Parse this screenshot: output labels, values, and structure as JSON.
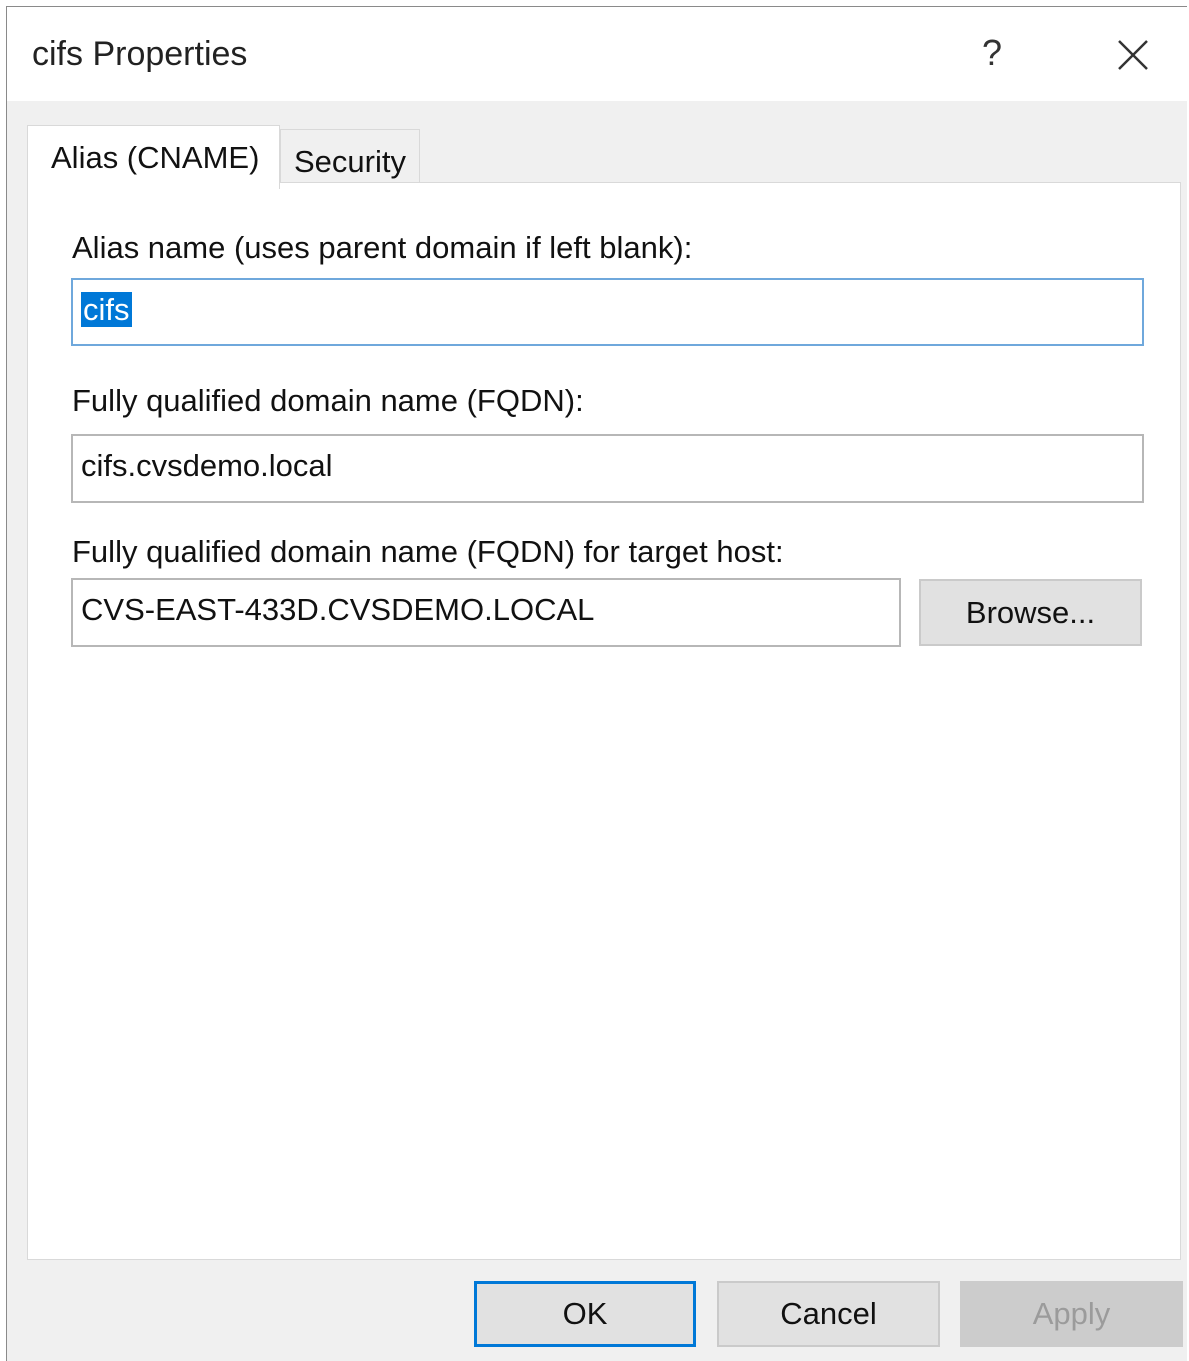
{
  "window": {
    "title": "cifs Properties",
    "help_glyph": "?",
    "close_icon": "close-icon"
  },
  "tabs": [
    {
      "label": "Alias (CNAME)",
      "active": true
    },
    {
      "label": "Security",
      "active": false
    }
  ],
  "form": {
    "alias_label": "Alias name (uses parent domain if left blank):",
    "alias_value": "cifs",
    "fqdn_label": "Fully qualified domain name (FQDN):",
    "fqdn_value": "cifs.cvsdemo.local",
    "target_label": "Fully qualified domain name (FQDN) for target host:",
    "target_value": "CVS-EAST-433D.CVSDEMO.LOCAL",
    "browse_label": "Browse..."
  },
  "buttons": {
    "ok": "OK",
    "cancel": "Cancel",
    "apply": "Apply"
  },
  "colors": {
    "selection": "#0078d7",
    "focus_border": "#6fa8dc"
  }
}
